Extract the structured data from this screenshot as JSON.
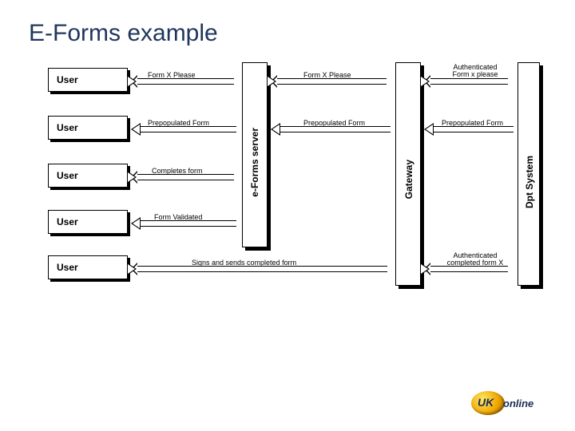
{
  "title": "E-Forms example",
  "users": {
    "u1": "User",
    "u2": "User",
    "u3": "User",
    "u4": "User",
    "u5": "User"
  },
  "columns": {
    "eforms": "e-Forms server",
    "gateway": "Gateway",
    "dpt": "Dpt System"
  },
  "arrows": {
    "a1": "Form X Please",
    "a2": "Form X Please",
    "a3": "Authenticated Form x please",
    "b1": "Prepopulated Form",
    "b2": "Prepopulated Form",
    "b3": "Prepopulated Form",
    "c1": "Completes form",
    "d1": "Form Validated",
    "e1": "Signs and sends completed form",
    "e2": "Authenticated completed form X"
  },
  "logo": {
    "uk": "UK",
    "online": "online"
  }
}
